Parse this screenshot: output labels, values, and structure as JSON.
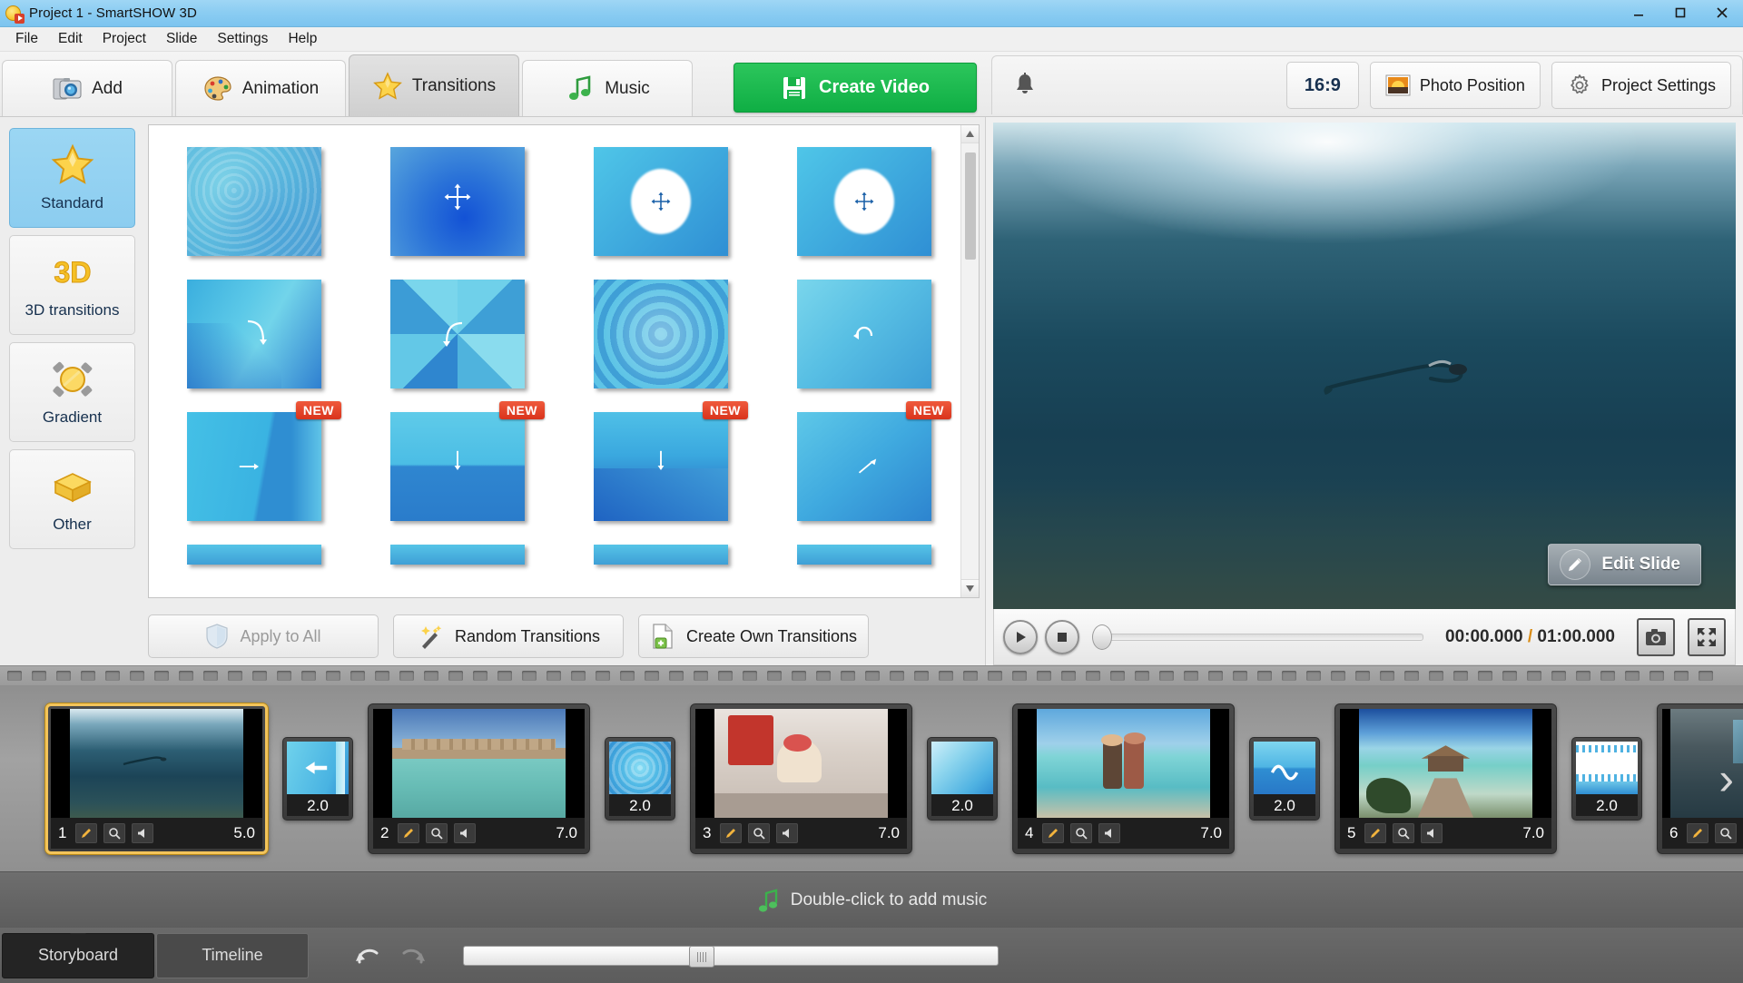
{
  "window": {
    "title": "Project 1 - SmartSHOW 3D",
    "app_icon": "smartshow-logo-icon",
    "controls": [
      {
        "name": "minimize-button",
        "glyph": "minimize-icon"
      },
      {
        "name": "maximize-button",
        "glyph": "maximize-icon"
      },
      {
        "name": "close-button",
        "glyph": "close-icon"
      }
    ]
  },
  "menubar": {
    "items": [
      "File",
      "Edit",
      "Project",
      "Slide",
      "Settings",
      "Help"
    ]
  },
  "toolbar": {
    "tabs": [
      {
        "label": "Add",
        "icon": "camera-icon",
        "active": false
      },
      {
        "label": "Animation",
        "icon": "palette-icon",
        "active": false
      },
      {
        "label": "Transitions",
        "icon": "star-icon",
        "active": true
      },
      {
        "label": "Music",
        "icon": "music-note-icon",
        "active": false
      }
    ],
    "create_video": "Create Video",
    "create_video_icon": "save-floppy-icon",
    "bell_icon": "notification-bell-icon",
    "aspect_ratio": "16:9",
    "photo_position": "Photo Position",
    "photo_position_icon": "photo-sunset-icon",
    "project_settings": "Project Settings",
    "project_settings_icon": "gear-icon"
  },
  "transitions_panel": {
    "categories": [
      {
        "label": "Standard",
        "icon": "gold-star-icon",
        "active": true
      },
      {
        "label": "3D transitions",
        "icon": "3d-text-icon",
        "active": false
      },
      {
        "label": "Gradient",
        "icon": "gradient-sphere-icon",
        "active": false
      },
      {
        "label": "Other",
        "icon": "yellow-box-icon",
        "active": false
      }
    ],
    "items": [
      {
        "name": "fade-transition",
        "glyph": "",
        "new": false,
        "style": "bubbles"
      },
      {
        "name": "move-transition",
        "glyph": "move",
        "new": false,
        "style": "radial-blue"
      },
      {
        "name": "zoom-circle-transition",
        "glyph": "move-circle",
        "new": false,
        "style": "circle-white"
      },
      {
        "name": "zoom-circle-2-transition",
        "glyph": "move-circle",
        "new": false,
        "style": "circle-white"
      },
      {
        "name": "curve-transition",
        "glyph": "curve-right",
        "new": false,
        "style": "diagonal"
      },
      {
        "name": "pinwheel-transition",
        "glyph": "curve-left",
        "new": false,
        "style": "pinwheel"
      },
      {
        "name": "ripple-transition",
        "glyph": "",
        "new": false,
        "style": "ripple"
      },
      {
        "name": "swirl-transition",
        "glyph": "curve-back",
        "new": false,
        "style": "soft-diagonal"
      },
      {
        "name": "slide-right-transition",
        "glyph": "arrow-right",
        "new": true,
        "style": "vertical-band"
      },
      {
        "name": "slide-down-transition",
        "glyph": "arrow-down",
        "new": true,
        "style": "horizontal-band"
      },
      {
        "name": "push-down-transition",
        "glyph": "arrow-down",
        "new": true,
        "style": "wave-blue"
      },
      {
        "name": "slide-up-right-transition",
        "glyph": "arrow-up-right",
        "new": true,
        "style": "soft-blue"
      }
    ],
    "buttons": [
      {
        "label": "Apply to All",
        "icon": "shield-icon",
        "disabled": true
      },
      {
        "label": "Random Transitions",
        "icon": "magic-wand-icon",
        "disabled": false
      },
      {
        "label": "Create Own Transitions",
        "icon": "new-page-plus-icon",
        "disabled": false
      }
    ],
    "scrollbar": {
      "up_icon": "chevron-up-icon",
      "down_icon": "chevron-down-icon"
    }
  },
  "preview": {
    "edit_slide": "Edit Slide",
    "edit_slide_icon": "pencil-icon",
    "play_icon": "play-icon",
    "stop_icon": "stop-icon",
    "time_current": "00:00.000",
    "time_separator": " / ",
    "time_total": "01:00.000",
    "snapshot_icon": "camera-snapshot-icon",
    "fullscreen_icon": "fullscreen-icon"
  },
  "storyboard": {
    "slides": [
      {
        "num": "1",
        "duration": "5.0",
        "selected": true,
        "scene": "underwater-diver"
      },
      {
        "num": "2",
        "duration": "7.0",
        "selected": false,
        "scene": "overwater-bungalows"
      },
      {
        "num": "3",
        "duration": "7.0",
        "selected": false,
        "scene": "ice-cream-cafe"
      },
      {
        "num": "4",
        "duration": "7.0",
        "selected": false,
        "scene": "couple-beach"
      },
      {
        "num": "5",
        "duration": "7.0",
        "selected": false,
        "scene": "resort-pier"
      },
      {
        "num": "6",
        "duration": "",
        "selected": false,
        "scene": "dark-water"
      }
    ],
    "transitions": [
      {
        "duration": "2.0",
        "glyph": "arrow-left",
        "style": "band"
      },
      {
        "duration": "2.0",
        "glyph": "",
        "style": "radial"
      },
      {
        "duration": "2.0",
        "glyph": "",
        "style": "soft"
      },
      {
        "duration": "2.0",
        "glyph": "wave",
        "style": "wave"
      },
      {
        "duration": "2.0",
        "glyph": "",
        "style": "filmstrip"
      }
    ],
    "slide_icons": [
      "edit-pencil-icon",
      "magnifier-icon",
      "speaker-icon"
    ],
    "next_arrow_icon": "chevron-right-icon"
  },
  "music_bar": {
    "label": "Double-click to add music",
    "icon": "green-music-note-icon"
  },
  "bottom_bar": {
    "tabs": [
      {
        "label": "Storyboard",
        "active": true
      },
      {
        "label": "Timeline",
        "active": false
      }
    ],
    "undo_icon": "undo-arrow-icon",
    "redo_icon": "redo-arrow-icon",
    "zoom_slider_name": "timeline-zoom-slider"
  },
  "colors": {
    "accent_green": "#17b348",
    "title_blue": "#8ccdf2",
    "badge_red": "#d9331c",
    "selected_gold": "#f3c45a",
    "selected_cat": "#8ccdf0"
  }
}
